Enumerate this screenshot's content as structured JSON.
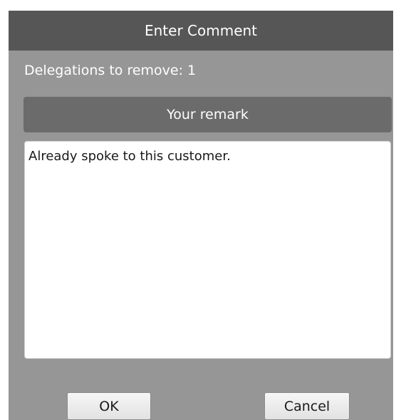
{
  "dialog": {
    "title": "Enter Comment",
    "info": "Delegations to remove: 1",
    "remark_header": "Your remark",
    "remark_value": "Already spoke to this customer.",
    "ok_label": "OK",
    "cancel_label": "Cancel"
  },
  "colors": {
    "title_bar": "#565656",
    "dialog_bg": "#969696",
    "section_header": "#6b6b6b"
  }
}
